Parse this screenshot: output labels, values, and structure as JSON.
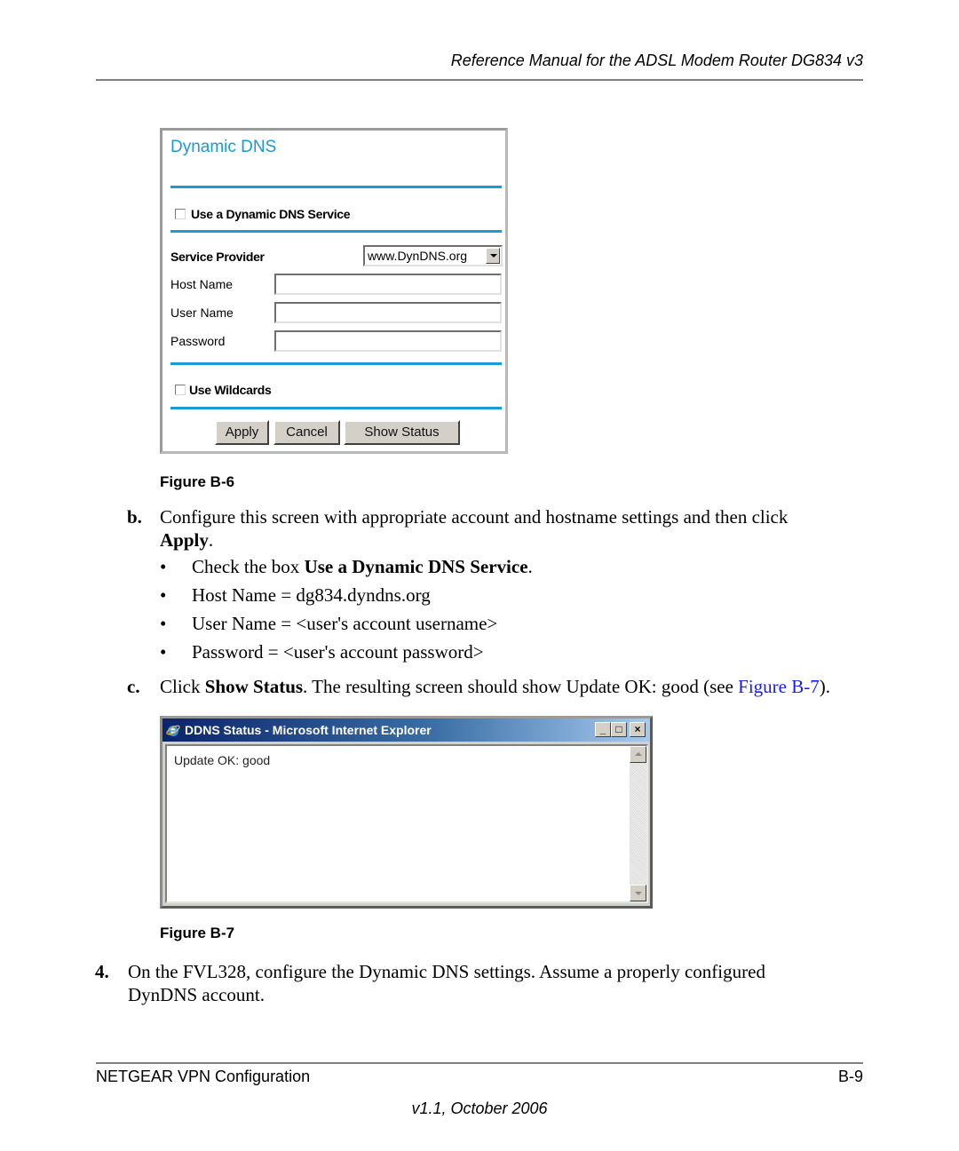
{
  "header": {
    "title": "Reference Manual for the ADSL Modem Router DG834 v3"
  },
  "figure_b6": {
    "title": "Dynamic DNS",
    "use_ddns_label": "Use a Dynamic DNS Service",
    "use_ddns_checked": false,
    "service_provider_label": "Service Provider",
    "service_provider_value": "www.DynDNS.org",
    "host_name_label": "Host Name",
    "host_name_value": "",
    "user_name_label": "User Name",
    "user_name_value": "",
    "password_label": "Password",
    "password_value": "",
    "use_wildcards_label": "Use Wildcards",
    "use_wildcards_checked": false,
    "buttons": {
      "apply": "Apply",
      "cancel": "Cancel",
      "show_status": "Show Status"
    },
    "accent_color": "#1a9ad6",
    "caption": "Figure B-6"
  },
  "step_b": {
    "marker": "b.",
    "text_1": "Configure this screen with appropriate account and hostname settings and then click",
    "apply_bold": "Apply",
    "text_end": ".",
    "bullets": [
      {
        "prefix": "Check the box ",
        "bold": "Use a Dynamic DNS Service",
        "suffix": "."
      },
      {
        "text": "Host Name = dg834.dyndns.org"
      },
      {
        "text": "User Name = <user's account username>"
      },
      {
        "text": "Password = <user's account password>"
      }
    ]
  },
  "step_c": {
    "marker": "c.",
    "prefix": "Click ",
    "bold": "Show Status",
    "middle": ". The resulting screen should show Update OK: good (see ",
    "link": "Figure B-7",
    "suffix": ").",
    "link_color": "#1a1aff"
  },
  "figure_b7": {
    "window_title": "DDNS Status - Microsoft Internet Explorer",
    "minimize_glyph": "_",
    "maximize_glyph": "□",
    "close_glyph": "×",
    "message": "Update OK: good",
    "caption": "Figure B-7"
  },
  "step_4": {
    "marker": "4.",
    "line_1": "On the FVL328, configure the Dynamic DNS settings. Assume a properly configured",
    "line_2": "DynDNS account."
  },
  "footer": {
    "left": "NETGEAR VPN Configuration",
    "right": "B-9",
    "version": "v1.1, October 2006"
  }
}
